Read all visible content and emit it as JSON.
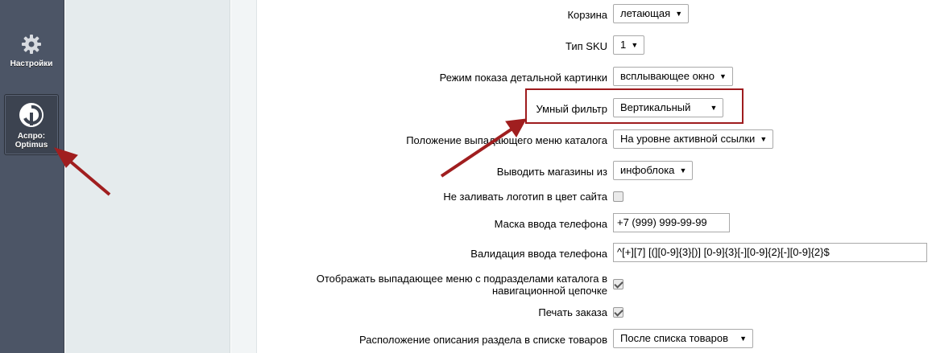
{
  "sidebar": {
    "settings": {
      "label": "Настройки",
      "icon": "gear-icon"
    },
    "aspro": {
      "label": "Аспро: Optimus",
      "icon": "aspro-logo-icon"
    }
  },
  "settings": {
    "cart": {
      "label": "Корзина",
      "value": "летающая"
    },
    "sku_type": {
      "label": "Тип SKU",
      "value": "1"
    },
    "detail_picture_mode": {
      "label": "Режим показа детальной картинки",
      "value": "всплывающее окно"
    },
    "smart_filter": {
      "label": "Умный фильтр",
      "value": "Вертикальный"
    },
    "catalog_menu_position": {
      "label": "Положение выпадающего меню каталога",
      "value": "На уровне активной ссылки"
    },
    "stores_source": {
      "label": "Выводить магазины из",
      "value": "инфоблока"
    },
    "logo_no_fill": {
      "label": "Не заливать логотип в цвет сайта",
      "checked": false
    },
    "phone_mask": {
      "label": "Маска ввода телефона",
      "value": "+7 (999) 999-99-99"
    },
    "phone_validation": {
      "label": "Валидация ввода телефона",
      "value": "^[+][7] [(][0-9]{3}[)] [0-9]{3}[-][0-9]{2}[-][0-9]{2}$"
    },
    "breadcrumb_dropdown": {
      "label": "Отображать выпадающее меню с подразделами каталога в навигационной цепочке",
      "checked": true
    },
    "print_order": {
      "label": "Печать заказа",
      "checked": true
    },
    "section_description": {
      "label": "Расположение описания раздела в списке товаров",
      "value": "После списка товаров"
    }
  },
  "colors": {
    "sidebar": "#4c5566",
    "panel": "#e5ebed",
    "highlight": "#9e1b1e"
  }
}
